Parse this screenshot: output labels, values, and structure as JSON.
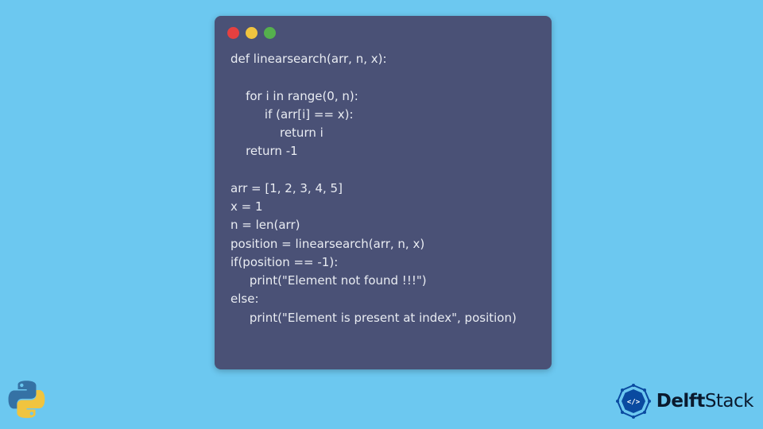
{
  "code_window": {
    "dots": [
      "red",
      "yellow",
      "green"
    ],
    "code": "def linearsearch(arr, n, x):\n\n    for i in range(0, n):\n         if (arr[i] == x):\n             return i\n    return -1\n\narr = [1, 2, 3, 4, 5]\nx = 1\nn = len(arr)\nposition = linearsearch(arr, n, x)\nif(position == -1):\n     print(\"Element not found !!!\")\nelse:\n     print(\"Element is present at index\", position)"
  },
  "brand": {
    "name_left": "Delft",
    "name_right": "Stack"
  }
}
